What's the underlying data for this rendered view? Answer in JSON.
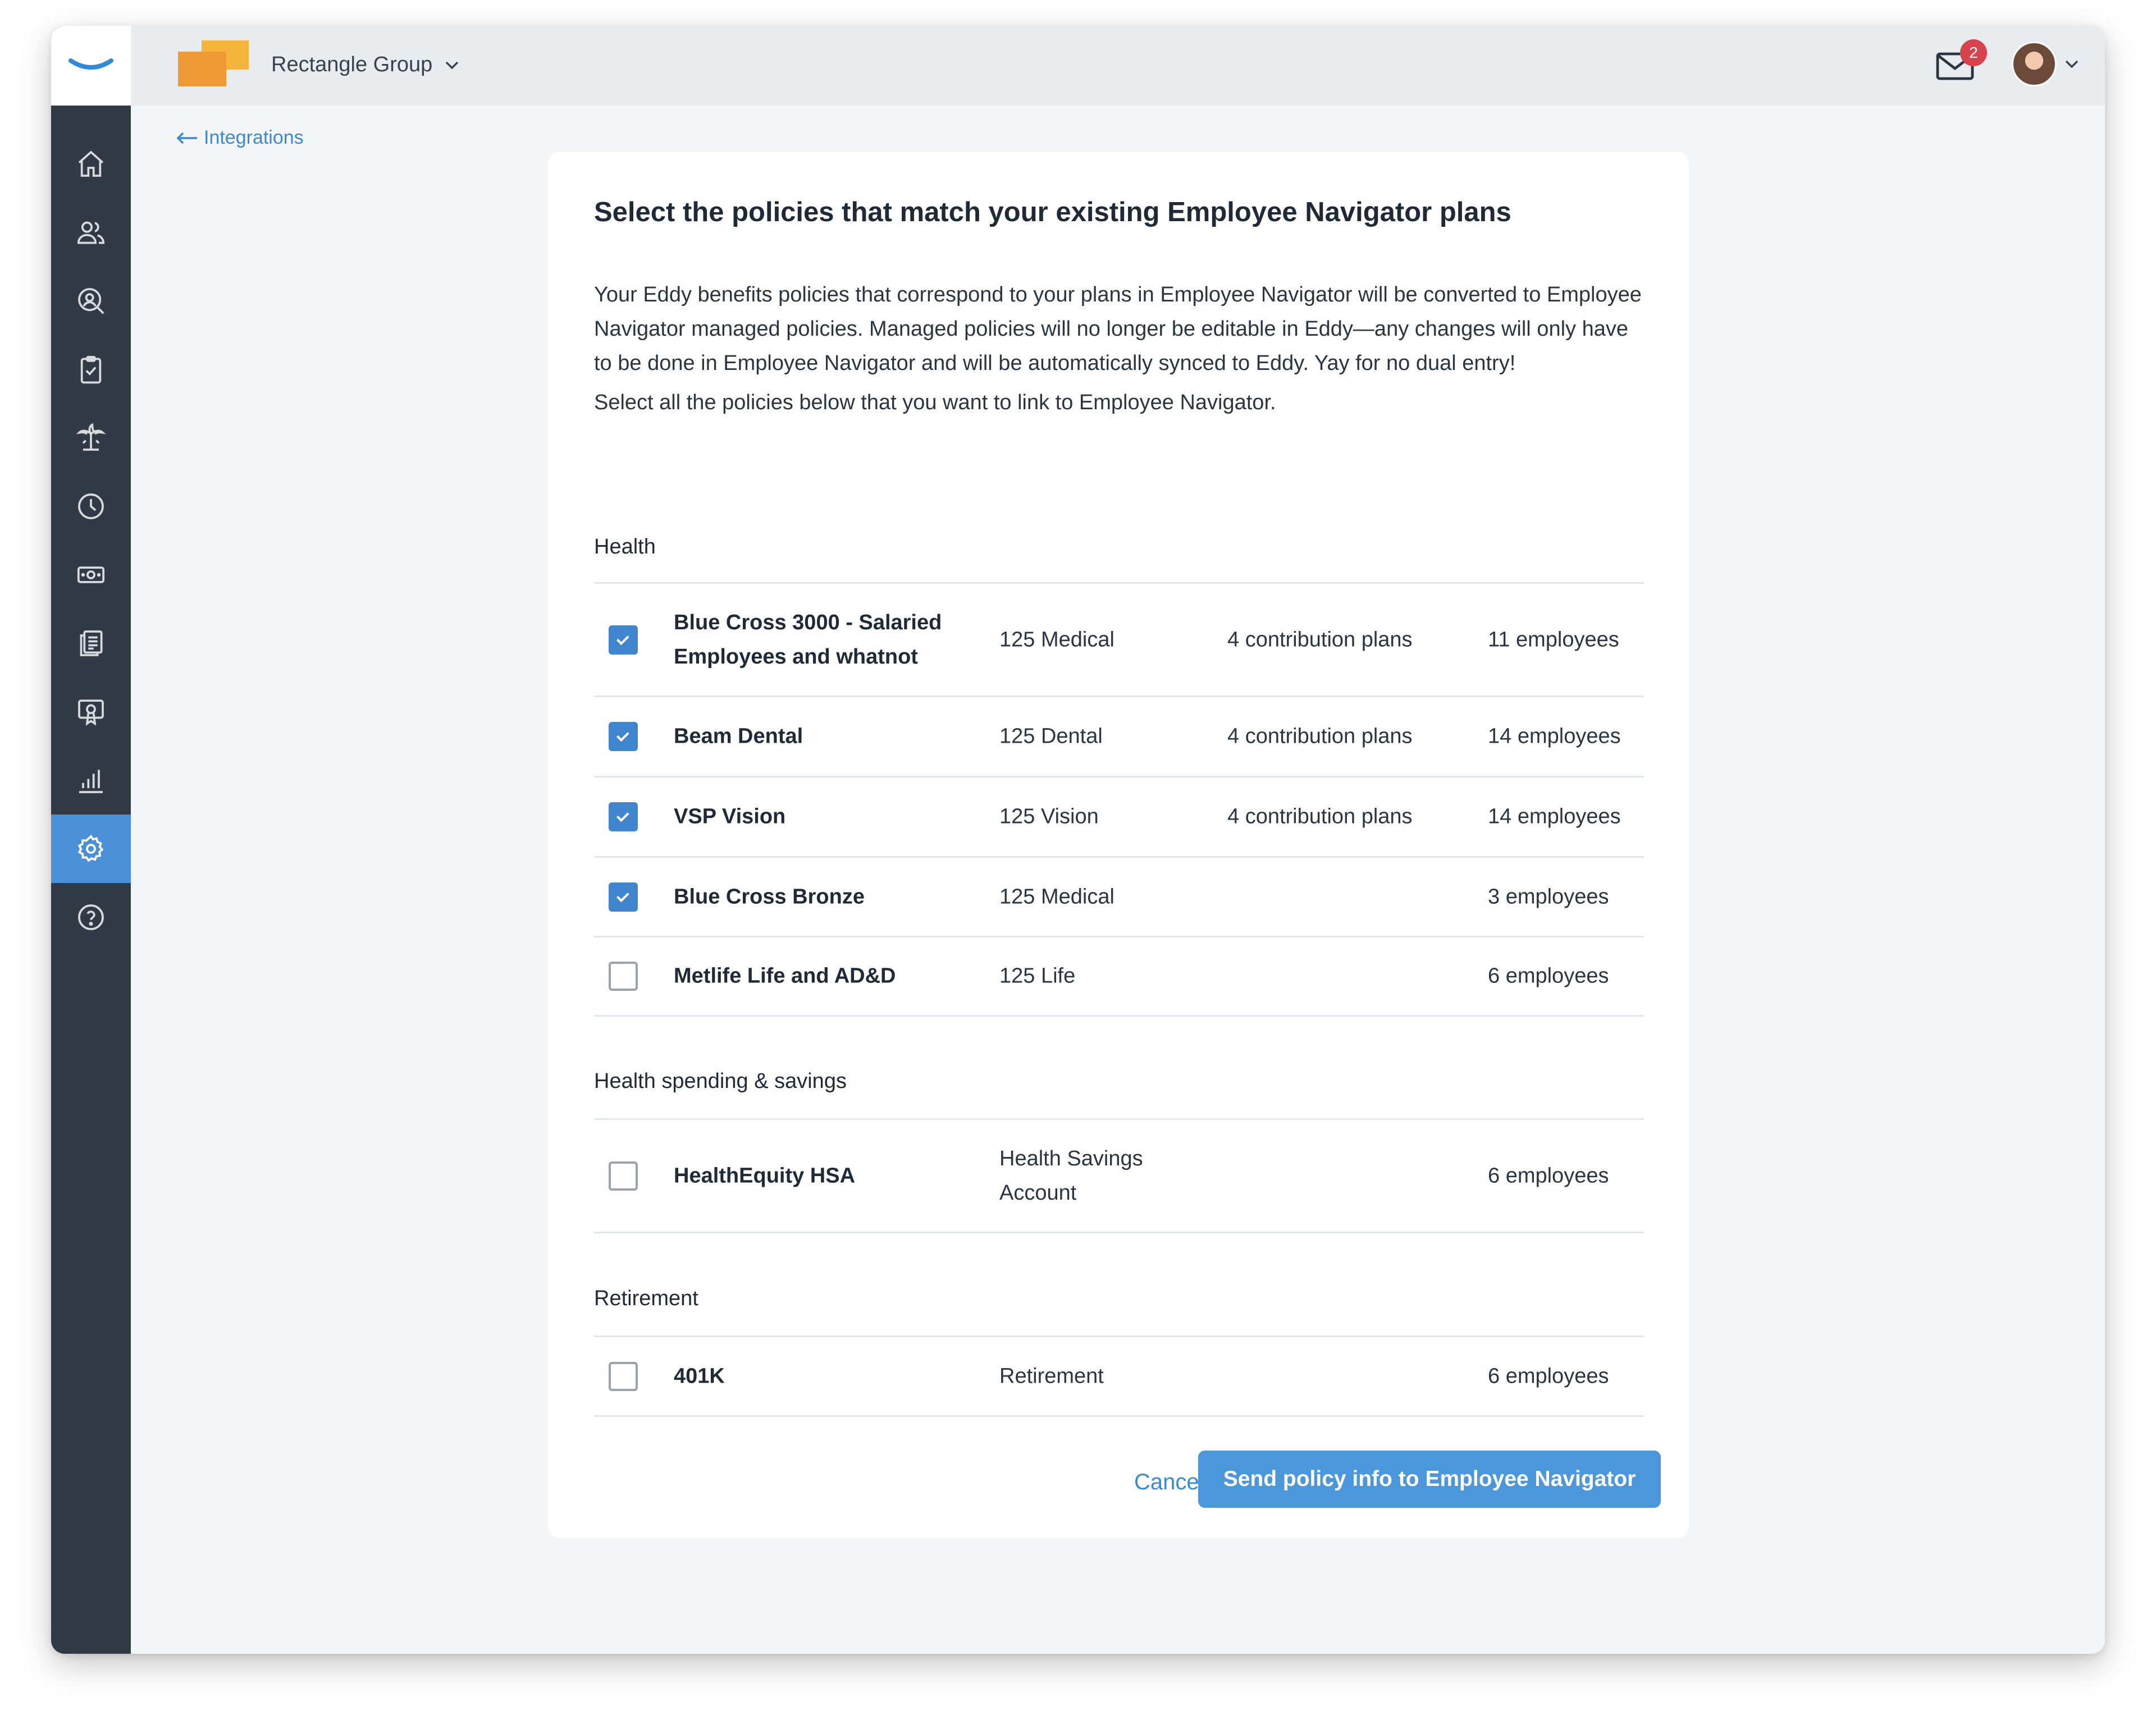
{
  "topbar": {
    "company_name": "Rectangle Group",
    "notification_count": "2",
    "brand_color": "#4a90d6"
  },
  "sidebar": {
    "items": [
      {
        "icon": "home-icon"
      },
      {
        "icon": "people-icon"
      },
      {
        "icon": "search-person-icon"
      },
      {
        "icon": "clipboard-check-icon"
      },
      {
        "icon": "palm-tree-icon"
      },
      {
        "icon": "clock-icon"
      },
      {
        "icon": "money-icon"
      },
      {
        "icon": "documents-icon"
      },
      {
        "icon": "award-icon"
      },
      {
        "icon": "reports-icon"
      },
      {
        "icon": "settings-icon",
        "active": true
      },
      {
        "icon": "help-icon"
      }
    ]
  },
  "breadcrumb": {
    "label": "Integrations"
  },
  "card": {
    "title": "Select the policies that match your existing Employee Navigator plans",
    "intro": "Your Eddy benefits policies that correspond to your plans in Employee Navigator will be converted to Employee Navigator managed policies. Managed policies will no longer be editable in Eddy—any changes will only have to be done in Employee Navigator and will be automatically synced to Eddy. Yay for no dual entry!",
    "intro2": "Select all the policies below that you want to link to Employee Navigator."
  },
  "sections": [
    {
      "title": "Health",
      "rows": [
        {
          "name": "Blue Cross 3000 - Salaried Employees and whatnot",
          "type": "125 Medical",
          "contrib": "4 contribution plans",
          "employees": "11 employees",
          "checked": true
        },
        {
          "name": "Beam Dental",
          "type": "125 Dental",
          "contrib": "4 contribution plans",
          "employees": "14 employees",
          "checked": true
        },
        {
          "name": "VSP Vision",
          "type": "125 Vision",
          "contrib": "4 contribution plans",
          "employees": "14 employees",
          "checked": true
        },
        {
          "name": "Blue Cross Bronze",
          "type": "125 Medical",
          "contrib": "",
          "employees": "3 employees",
          "checked": true
        },
        {
          "name": "Metlife Life and AD&D",
          "type": "125 Life",
          "contrib": "",
          "employees": "6 employees",
          "checked": false
        }
      ]
    },
    {
      "title": "Health spending & savings",
      "rows": [
        {
          "name": "HealthEquity HSA",
          "type": "Health Savings Account",
          "contrib": "",
          "employees": "6 employees",
          "checked": false
        }
      ]
    },
    {
      "title": "Retirement",
      "rows": [
        {
          "name": "401K",
          "type": "Retirement",
          "contrib": "",
          "employees": "6 employees",
          "checked": false
        }
      ]
    }
  ],
  "actions": {
    "cancel_label": "Cancel",
    "send_label": "Send policy info to Employee Navigator"
  }
}
